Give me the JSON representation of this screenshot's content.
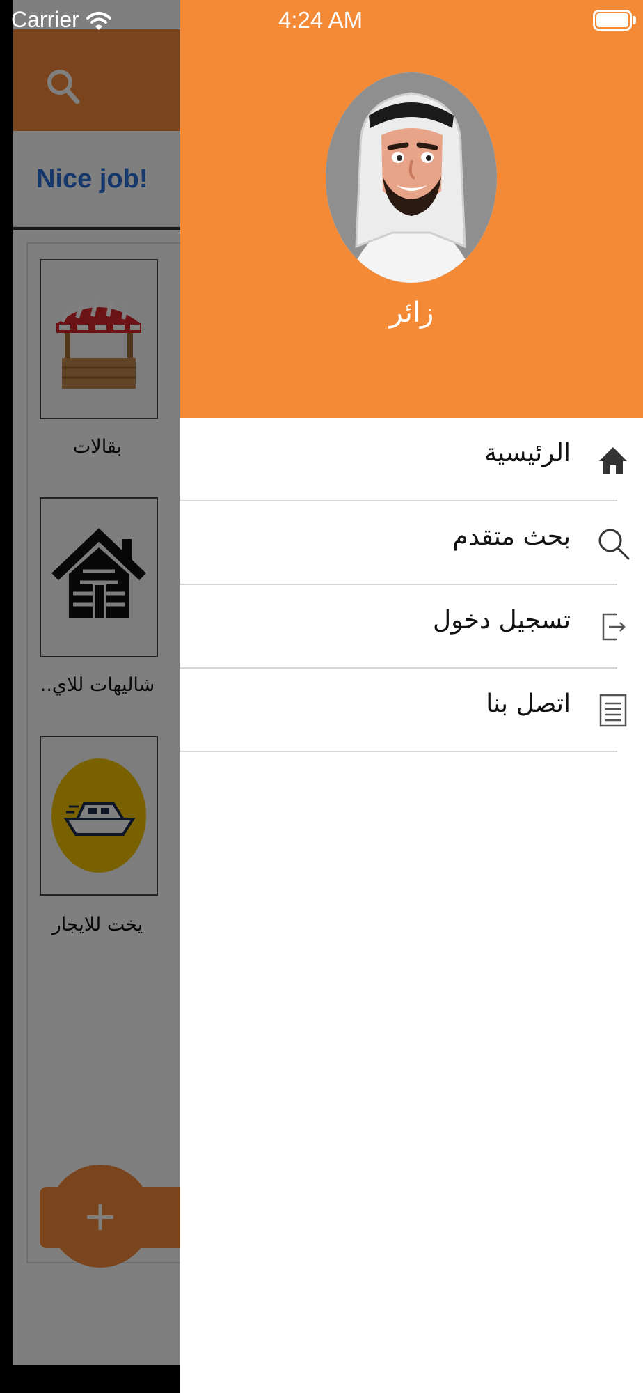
{
  "status_bar": {
    "carrier": "Carrier",
    "time": "4:24 AM"
  },
  "background_app": {
    "ad_text": "Nice job!",
    "categories": [
      {
        "label": "بقالات",
        "icon": "market-stall-icon"
      },
      {
        "label": "شاليهات للاي..",
        "icon": "cabin-icon"
      },
      {
        "label": "يخت للايجار",
        "icon": "yacht-icon"
      }
    ],
    "add_label": "+",
    "colors": {
      "accent": "#f4883a"
    }
  },
  "drawer": {
    "user_name": "زائر",
    "header_color": "#f48936",
    "menu": [
      {
        "label": "الرئيسية",
        "icon": "home-icon"
      },
      {
        "label": "بحث متقدم",
        "icon": "search-icon"
      },
      {
        "label": "تسجيل دخول",
        "icon": "login-icon"
      },
      {
        "label": "اتصل بنا",
        "icon": "document-icon"
      }
    ]
  }
}
